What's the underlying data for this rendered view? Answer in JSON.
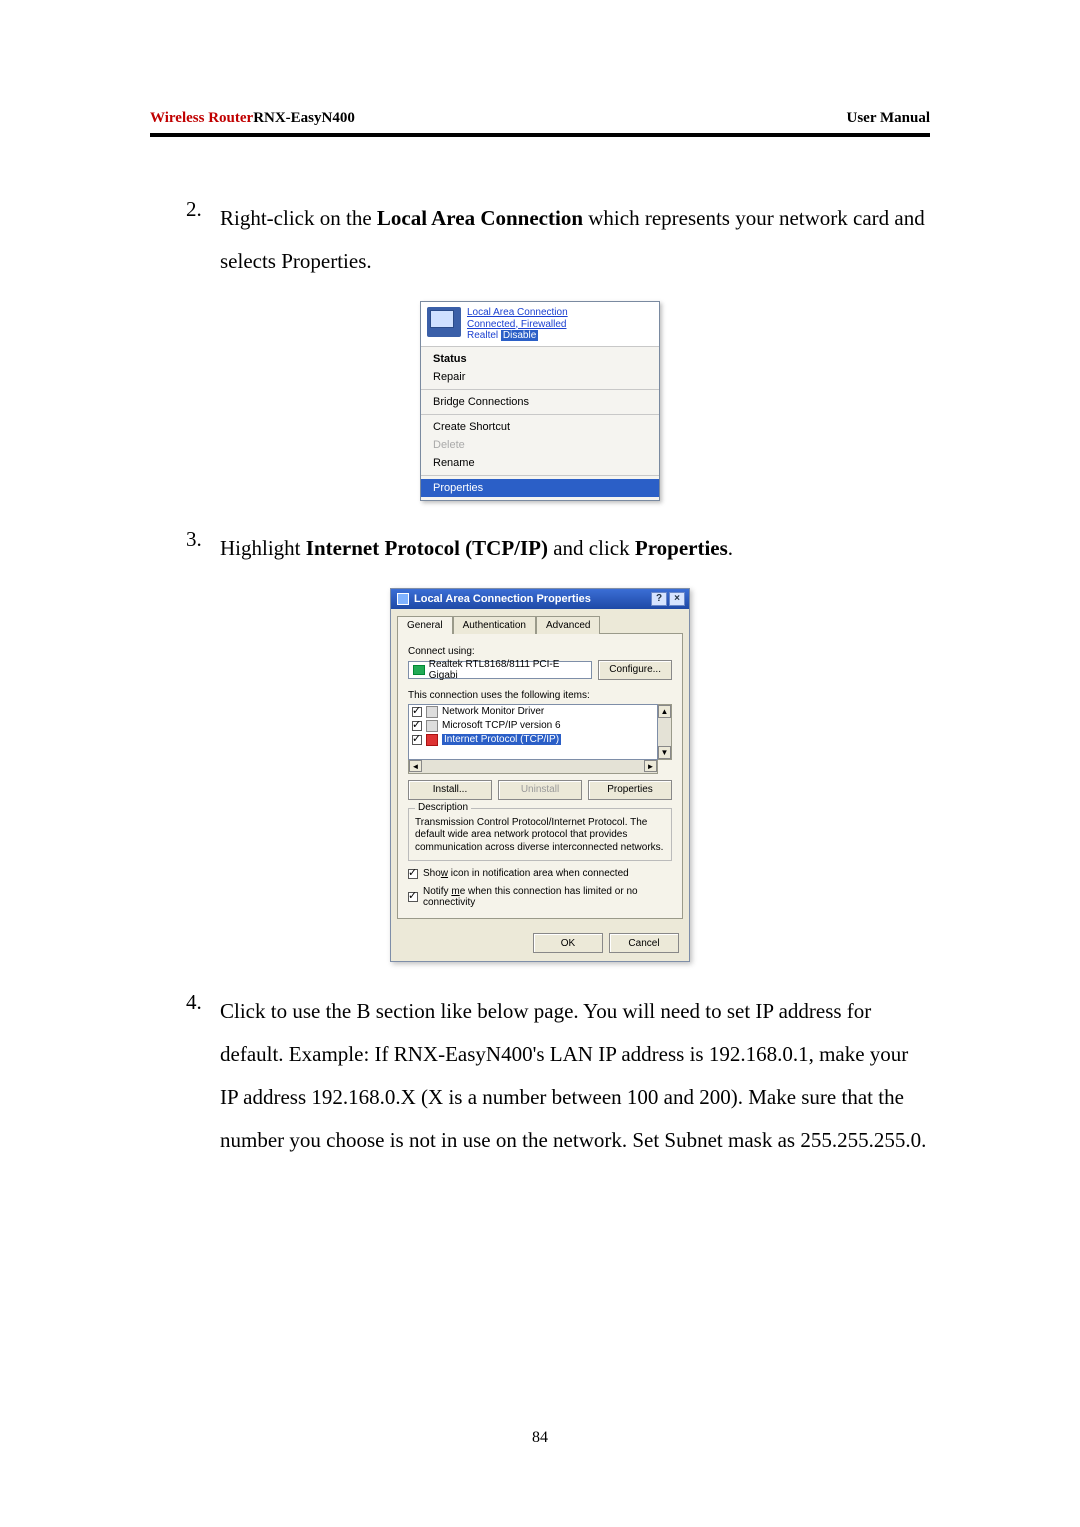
{
  "header": {
    "brand": "Wireless Router",
    "model": "RNX-EasyN400",
    "right": "User Manual"
  },
  "steps": {
    "s2": {
      "num": "2.",
      "pre": "Right-click on the ",
      "bold": "Local Area Connection",
      "post": " which represents your network card and selects Properties."
    },
    "s3": {
      "num": "3.",
      "pre": "Highlight ",
      "bold": "Internet Protocol (TCP/IP)",
      "mid": " and click ",
      "bold2": "Properties",
      "post": "."
    },
    "s4": {
      "num": "4.",
      "text": "Click to use the B section like below page. You will need to set IP address for default. Example: If RNX-EasyN400's LAN IP address is 192.168.0.1, make your IP address 192.168.0.X (X is a number between 100 and 200). Make sure that the number you choose is not in use on the network. Set Subnet mask as 255.255.255.0."
    }
  },
  "contextMenu": {
    "top": {
      "line1": "Local Area Connection",
      "line2": "Connected, Firewalled",
      "line3a": "Realtel",
      "line3b": "Disable"
    },
    "items": {
      "status": "Status",
      "repair": "Repair",
      "bridge": "Bridge Connections",
      "shortcut": "Create Shortcut",
      "delete": "Delete",
      "rename": "Rename",
      "properties": "Properties"
    }
  },
  "dialog": {
    "title": "Local Area Connection Properties",
    "helpBtn": "?",
    "closeBtn": "×",
    "tabs": {
      "general": "General",
      "auth": "Authentication",
      "adv": "Advanced"
    },
    "connectUsing": "Connect using:",
    "adapter": "Realtek RTL8168/8111 PCI-E Gigabi",
    "configure": "Configure...",
    "usesItems": "This connection uses the following items:",
    "list": {
      "i1": "Network Monitor Driver",
      "i2": "Microsoft TCP/IP version 6",
      "i3": "Internet Protocol (TCP/IP)"
    },
    "install": "Install...",
    "uninstall": "Uninstall",
    "properties": "Properties",
    "descLegend": "Description",
    "descText": "Transmission Control Protocol/Internet Protocol. The default wide area network protocol that provides communication across diverse interconnected networks.",
    "chk1a": "Sho",
    "chk1b": "w",
    "chk1c": " icon in notification area when connected",
    "chk2a": "Notify ",
    "chk2b": "m",
    "chk2c": "e when this connection has limited or no connectivity",
    "ok": "OK",
    "cancel": "Cancel"
  },
  "pageNumber": "84"
}
